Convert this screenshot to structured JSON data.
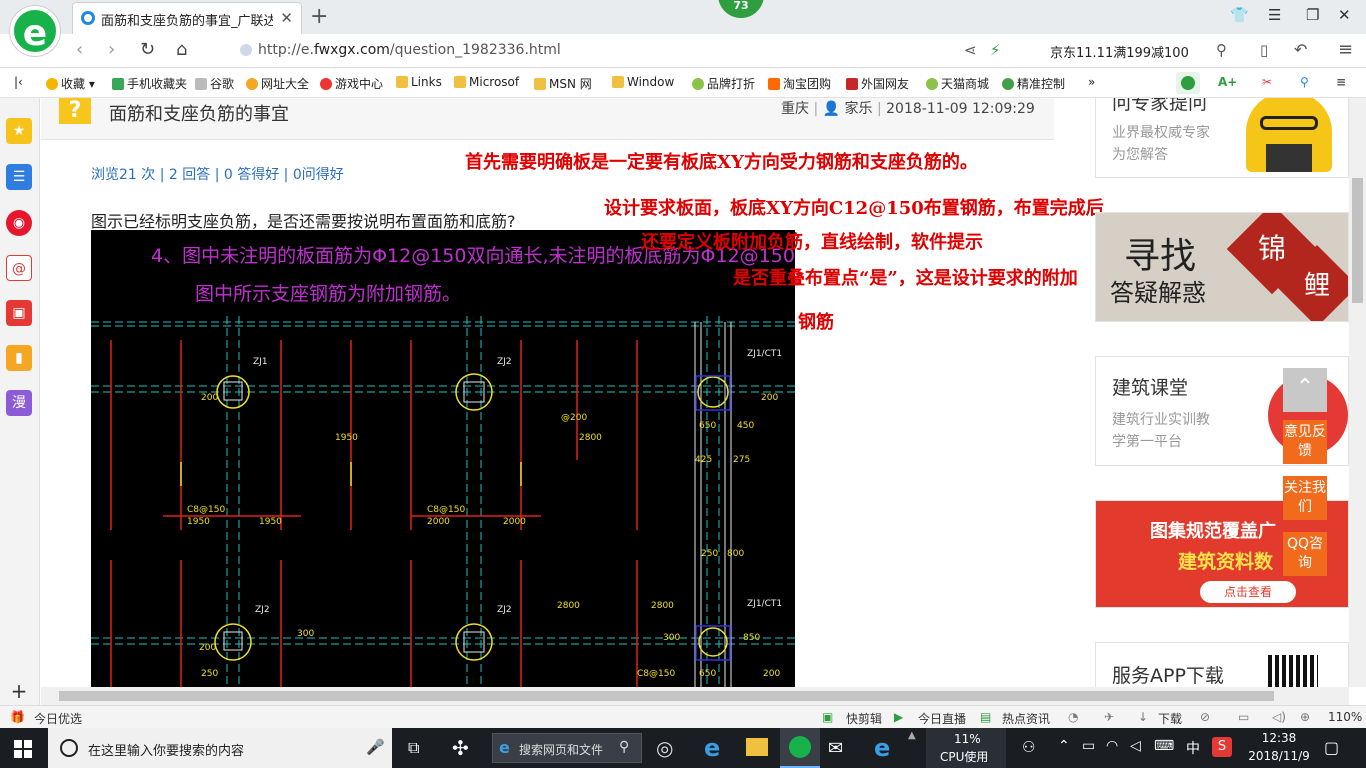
{
  "browser": {
    "tab_title": "面筋和支座负筋的事宜_广联达服",
    "badge": "73",
    "url_prefix": "http://e.",
    "url_domain": "fwxgx.com",
    "url_path": "/question_1982336.html",
    "search_promo": "京东11.11满199减100",
    "logo_letter": "e"
  },
  "bookmarks": [
    {
      "label": "收藏",
      "color": "#f5b400"
    },
    {
      "label": "手机收藏夹",
      "color": "#3aa657"
    },
    {
      "label": "谷歌",
      "color": "#9e9e9e"
    },
    {
      "label": "网址大全",
      "color": "#f5a623"
    },
    {
      "label": "游戏中心",
      "color": "#e33"
    },
    {
      "label": "Links",
      "color": "#f0c040"
    },
    {
      "label": "Microsof",
      "color": "#f0c040"
    },
    {
      "label": "MSN 网",
      "color": "#f0c040"
    },
    {
      "label": "Window",
      "color": "#f0c040"
    },
    {
      "label": "品牌打折",
      "color": "#8bc34a"
    },
    {
      "label": "淘宝团购",
      "color": "#ff6a00"
    },
    {
      "label": "外国网友",
      "color": "#c62828"
    },
    {
      "label": "天猫商城",
      "color": "#8bc34a"
    },
    {
      "label": "精准控制",
      "color": "#43a047"
    }
  ],
  "question": {
    "title": "面筋和支座负筋的事宜",
    "location": "重庆",
    "user": "家乐",
    "datetime": "2018-11-09 12:09:29",
    "stats": {
      "views": "浏览21 次",
      "answers": "2 回答",
      "good": "0 答得好",
      "asks": "0问得好"
    },
    "text": "图示已经标明支座负筋，是否还需要按说明布置面筋和底筋?"
  },
  "annotations": [
    "首先需要明确板是一定要有板底XY方向受力钢筋和支座负筋的。",
    "设计要求板面，板底XY方向C12@150布置钢筋，布置完成后",
    "还要定义板附加负筋，直线绘制，软件提示",
    "是否重叠布置点“是”，这是设计要求的附加",
    "钢筋"
  ],
  "cad": {
    "note_line1": "4、图中未注明的板面筋为Φ12@150双向通长,未注明的板底筋为Φ12@150双向通长。",
    "note_line2": "图中所示支座钢筋为附加钢筋。",
    "labels": [
      "ZJ1",
      "ZJ2",
      "ZJ1/CT1",
      "ZJ2",
      "ZJ2",
      "ZJ1/CT1",
      "1950",
      "1950",
      "2000",
      "2000",
      "200",
      "200",
      "1950",
      "2800",
      "@200",
      "650",
      "450",
      "425",
      "275",
      "250",
      "800",
      "300",
      "200",
      "2800",
      "2800",
      "850",
      "650",
      "300",
      "250",
      "C8@150",
      "C8@150",
      "C8@150",
      "200"
    ]
  },
  "sidebar_right": {
    "expert_title": "问专家提问",
    "expert_sub1": "业界最权威专家",
    "expert_sub2": "为您解答",
    "ad1_big": "寻找",
    "ad1_sub": "答疑解惑",
    "ad1_seal1": "锦",
    "ad1_seal2": "鲤",
    "course_title": "建筑课堂",
    "course_sub1": "建筑行业实训教",
    "course_sub2": "学第一平台",
    "ad2_line1": "图集规范覆盖广",
    "ad2_line2": "建筑资料数",
    "ad2_btn": "点击查看",
    "app_title": "服务APP下载"
  },
  "float_buttons": [
    "意见反馈",
    "关注我们",
    "QQ咨询"
  ],
  "left_sidebar": [
    "收藏",
    "资讯",
    "微博",
    "邮件",
    "游戏",
    "笔记",
    "漫"
  ],
  "statusbar": {
    "left": "今日优选",
    "items": [
      "快剪辑",
      "今日直播",
      "热点资讯",
      "下载"
    ],
    "zoom": "110%"
  },
  "taskbar": {
    "search_placeholder": "在这里输入你要搜索的内容",
    "web_search": "搜索网页和文件",
    "cpu_percent": "11%",
    "cpu_label": "CPU使用",
    "ime": "中",
    "time": "12:38",
    "date": "2018/11/9"
  }
}
